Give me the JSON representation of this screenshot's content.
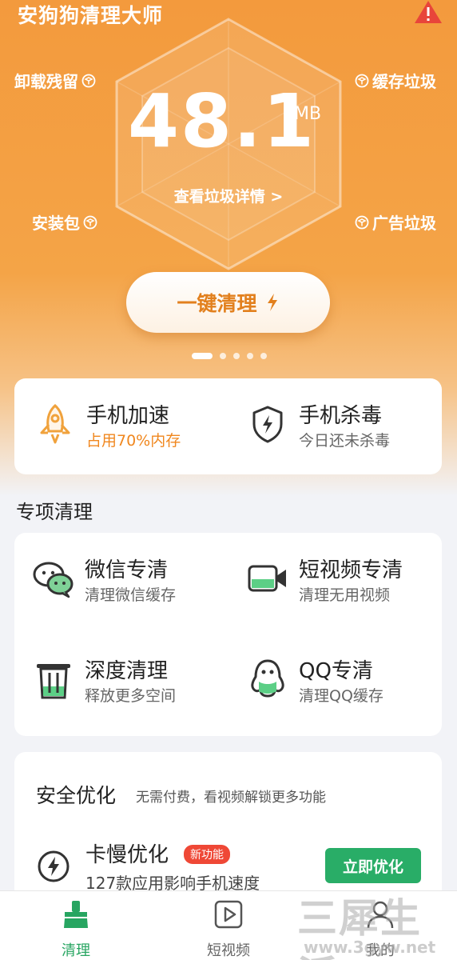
{
  "header": {
    "app_title": "安狗狗清理大师",
    "warning_icon": "warning-triangle-icon"
  },
  "summary": {
    "junk_size": "48.1",
    "unit": "MB",
    "detail_link": "查看垃圾详情 >",
    "corners": {
      "top_left": "卸载残留",
      "top_right": "缓存垃圾",
      "bottom_left": "安装包",
      "bottom_right": "广告垃圾"
    },
    "clean_button": "一键清理",
    "page_dots": {
      "count": 5,
      "active": 0
    }
  },
  "quick_tools": [
    {
      "title": "手机加速",
      "subtitle": "占用70%内存",
      "icon": "rocket-icon"
    },
    {
      "title": "手机杀毒",
      "subtitle": "今日还未杀毒",
      "icon": "shield-bolt-icon"
    }
  ],
  "special_clean": {
    "section_title": "专项清理",
    "items": [
      {
        "title": "微信专清",
        "subtitle": "清理微信缓存",
        "icon": "wechat-icon"
      },
      {
        "title": "短视频专清",
        "subtitle": "清理无用视频",
        "icon": "video-camera-icon"
      },
      {
        "title": "深度清理",
        "subtitle": "释放更多空间",
        "icon": "trash-icon"
      },
      {
        "title": "QQ专清",
        "subtitle": "清理QQ缓存",
        "icon": "qq-penguin-icon"
      }
    ]
  },
  "safety": {
    "title": "安全优化",
    "note": "无需付费，看视频解锁更多功能",
    "item": {
      "title": "卡慢优化",
      "badge": "新功能",
      "subtitle": "127款应用影响手机速度",
      "button": "立即优化",
      "icon": "lightning-circle-icon"
    }
  },
  "tabbar": [
    {
      "label": "清理",
      "icon": "broom-icon",
      "active": true
    },
    {
      "label": "短视频",
      "icon": "play-icon",
      "active": false
    },
    {
      "label": "我的",
      "icon": "user-icon",
      "active": false
    }
  ],
  "watermark": {
    "text": "三犀生活",
    "url": "www.3gyw.net"
  },
  "colors": {
    "accent_orange": "#f39a3d",
    "green": "#29ad67",
    "badge_red": "#ef4836"
  }
}
